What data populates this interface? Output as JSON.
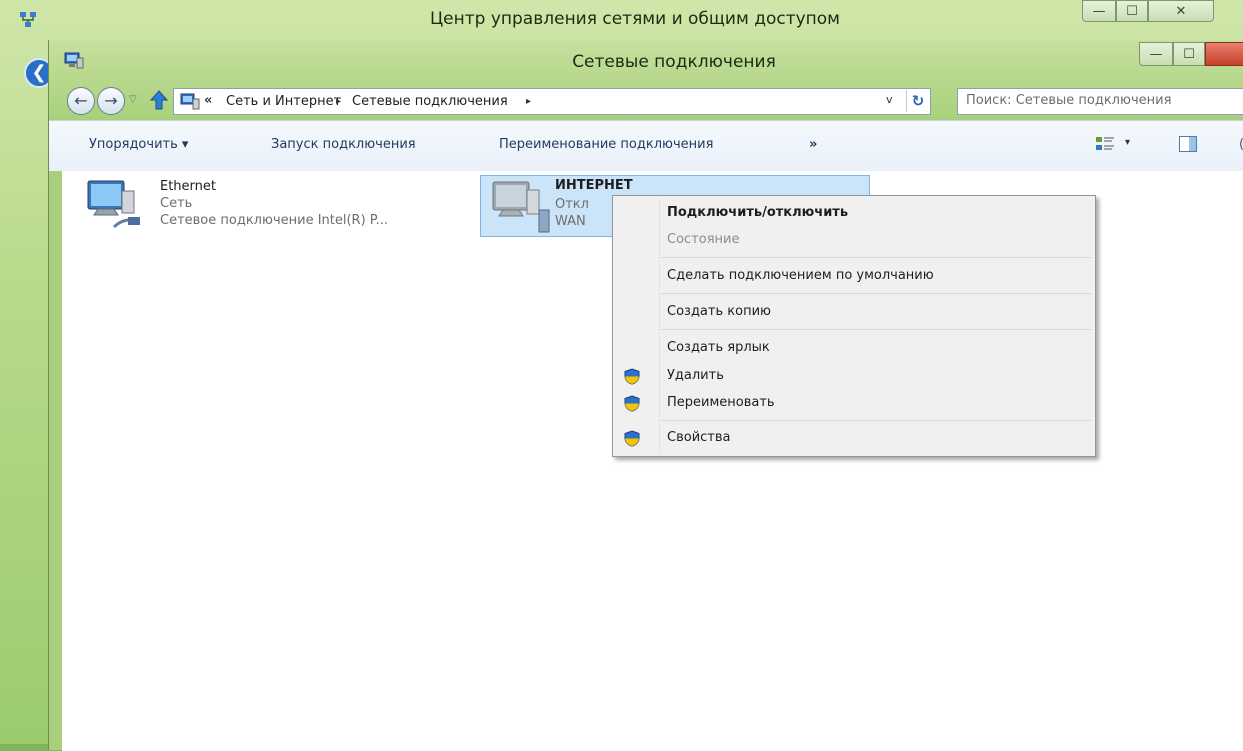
{
  "outer_window": {
    "title": "Центр управления сетями и общим доступом",
    "controls": {
      "minimize": "—",
      "maximize": "☐",
      "close": "✕"
    }
  },
  "inner_window": {
    "title": "Сетевые подключения",
    "controls": {
      "minimize": "—",
      "maximize": "☐"
    }
  },
  "navigation": {
    "back": "←",
    "forward": "→",
    "recent": "▽",
    "breadcrumb_overflow": "«",
    "breadcrumbs": [
      {
        "label": "Сеть и Интернет",
        "separator": "▸"
      },
      {
        "label": "Сетевые подключения",
        "separator": "▸"
      }
    ],
    "dropdown": "v",
    "refresh": "↻",
    "search_placeholder": "Поиск: Сетевые подключения"
  },
  "commandbar": {
    "organize": "Упорядочить ▾",
    "start_connection": "Запуск подключения",
    "rename_connection": "Переименование подключения",
    "more": "»",
    "view_arrow": "▾",
    "help": "("
  },
  "connections": [
    {
      "name": "Ethernet",
      "status": "Сеть",
      "device": "Сетевое подключение Intel(R) P..."
    },
    {
      "name": "ИНТЕРНЕТ",
      "status": "Откл",
      "device": "WAN"
    }
  ],
  "context_menu": {
    "items": [
      {
        "label": "Подключить/отключить",
        "default": true
      },
      {
        "label": "Состояние",
        "disabled": true
      },
      {
        "label": "Сделать подключением по умолчанию"
      },
      {
        "label": "Создать копию"
      },
      {
        "label": "Создать ярлык"
      },
      {
        "label": "Удалить",
        "icon": "uac-shield-icon"
      },
      {
        "label": "Переименовать",
        "icon": "uac-shield-icon"
      },
      {
        "label": "Свойства",
        "icon": "uac-shield-icon"
      }
    ]
  },
  "colors": {
    "aero_frame": "#a8d07a",
    "selection": "#cce4f7",
    "close_button": "#c6402b",
    "menu_background": "#f0f0f0"
  }
}
